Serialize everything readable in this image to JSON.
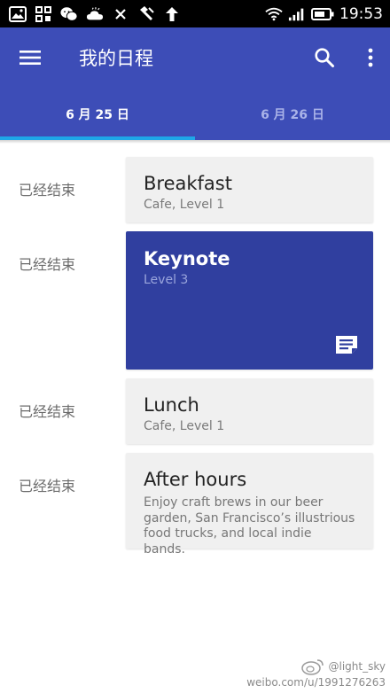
{
  "status_bar": {
    "time": "19:53",
    "left_icons": [
      "image-icon",
      "app-grid-icon",
      "wechat-icon",
      "weather-cloud-icon",
      "close-icon",
      "tool-icon",
      "upload-arrow-icon"
    ],
    "right_icons": [
      "wifi-icon",
      "signal-icon",
      "battery-icon"
    ]
  },
  "app_bar": {
    "title": "我的日程",
    "background_color": "#3d4db7",
    "icons": [
      "menu-icon",
      "search-icon",
      "more-vert-icon"
    ]
  },
  "tabs": [
    {
      "label": "6 月 25 日",
      "active": true
    },
    {
      "label": "6 月 26 日",
      "active": false
    }
  ],
  "accent_color": "#1ea7e8",
  "sessions": [
    {
      "status": "已经结束",
      "title": "Breakfast",
      "subtitle": "Cafe, Level 1"
    },
    {
      "status": "已经结束",
      "title": "Keynote",
      "subtitle": "Level 3",
      "featured": true,
      "featured_color": "#303f9f",
      "icon": "note-icon"
    },
    {
      "status": "已经结束",
      "title": "Lunch",
      "subtitle": "Cafe, Level 1"
    },
    {
      "status": "已经结束",
      "title": "After hours",
      "subtitle": "Enjoy craft brews in our beer garden, San Francisco’s illustrious food trucks, and local indie bands."
    }
  ],
  "watermark": {
    "handle": "@light_sky",
    "url": "weibo.com/u/1991276263",
    "icon": "weibo-icon"
  }
}
